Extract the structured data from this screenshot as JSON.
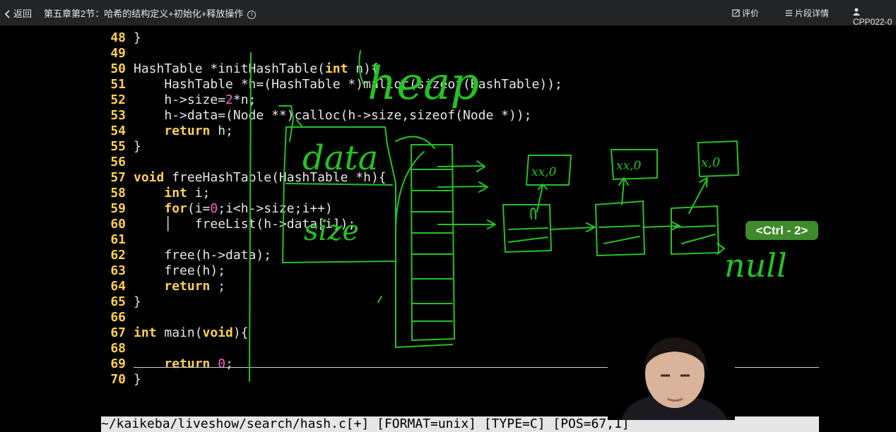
{
  "topbar": {
    "back_label": "返回",
    "title": "第五章第2节：哈希的结构定义+初始化+释放操作",
    "info_glyph": "i",
    "rate_label": "评价",
    "details_label": "片段详情",
    "course_code": "CPP022-0"
  },
  "code": {
    "lines": [
      {
        "n": "48",
        "t": "}"
      },
      {
        "n": "49",
        "t": ""
      },
      {
        "n": "50",
        "t": "HashTable *initHashTable(int n){"
      },
      {
        "n": "51",
        "t": "    HashTable *h=(HashTable *)malloc(sizeof(HashTable));"
      },
      {
        "n": "52",
        "t": "    h->size=2*n;"
      },
      {
        "n": "53",
        "t": "    h->data=(Node **)calloc(h->size,sizeof(Node *));"
      },
      {
        "n": "54",
        "t": "    return h;"
      },
      {
        "n": "55",
        "t": "}"
      },
      {
        "n": "56",
        "t": ""
      },
      {
        "n": "57",
        "t": "void freeHashTable(HashTable *h){"
      },
      {
        "n": "58",
        "t": "    int i;"
      },
      {
        "n": "59",
        "t": "    for(i=0;i<h->size;i++)"
      },
      {
        "n": "60",
        "t": "    │   freeList(h->data[i]);"
      },
      {
        "n": "61",
        "t": ""
      },
      {
        "n": "62",
        "t": "    free(h->data);"
      },
      {
        "n": "63",
        "t": "    free(h);"
      },
      {
        "n": "64",
        "t": "    return ;"
      },
      {
        "n": "65",
        "t": "}"
      },
      {
        "n": "66",
        "t": ""
      },
      {
        "n": "67",
        "t": "int main(void){"
      },
      {
        "n": "68",
        "t": ""
      },
      {
        "n": "69",
        "t": "    return 0;"
      },
      {
        "n": "70",
        "t": "}"
      }
    ],
    "status_line": "~/kaikeba/liveshow/search/hash.c[+] [FORMAT=unix] [TYPE=C] [POS=67,1]"
  },
  "overlay": {
    "shortcut_badge": "<Ctrl - 2>"
  },
  "annotations": {
    "heap": "heap",
    "data": "data",
    "size": "size",
    "null": "null",
    "node1": "xx,0",
    "node2": "xx,0",
    "node3": "x,0",
    "ink_color": "#22c322"
  }
}
